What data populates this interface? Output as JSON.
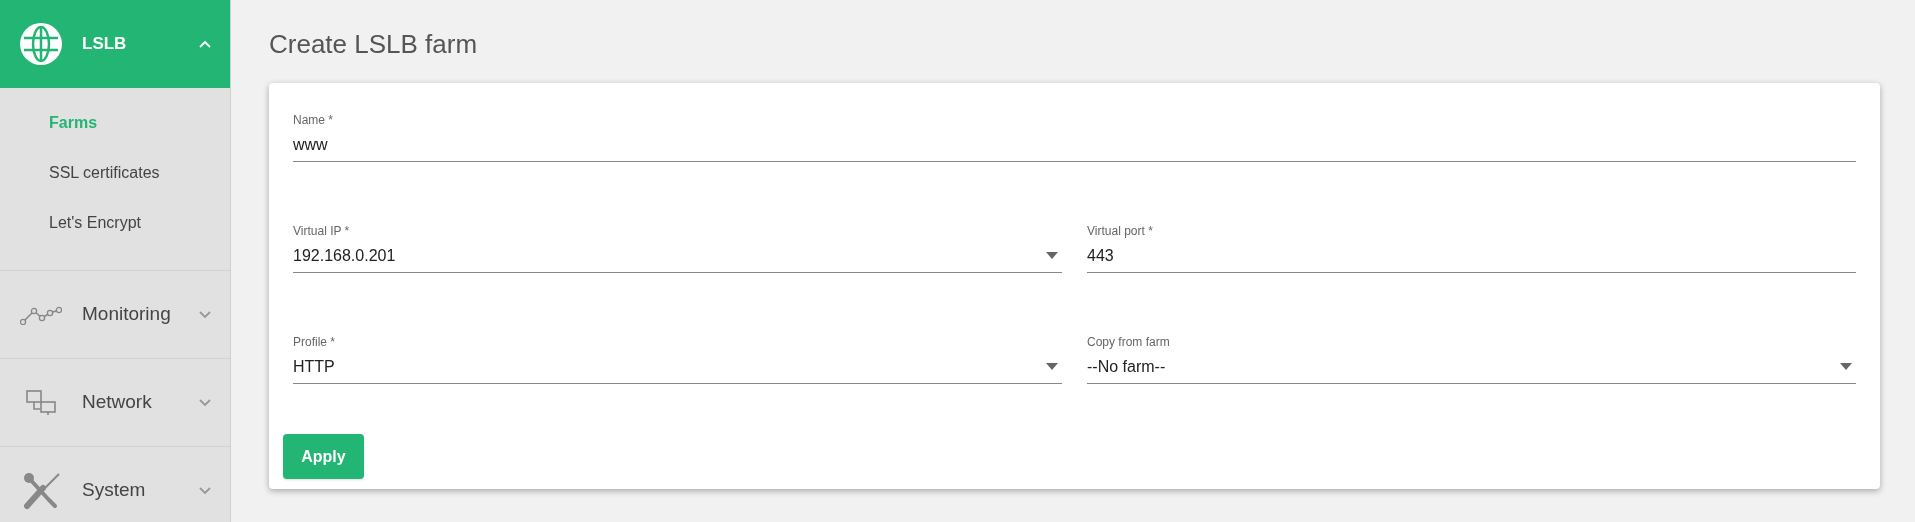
{
  "sidebar": {
    "sections": [
      {
        "label": "LSLB",
        "expanded": true,
        "selected": true,
        "items": [
          {
            "label": "Farms",
            "selected": true
          },
          {
            "label": "SSL certificates",
            "selected": false
          },
          {
            "label": "Let's Encrypt",
            "selected": false
          }
        ]
      },
      {
        "label": "Monitoring",
        "expanded": false,
        "selected": false
      },
      {
        "label": "Network",
        "expanded": false,
        "selected": false
      },
      {
        "label": "System",
        "expanded": false,
        "selected": false
      }
    ]
  },
  "page": {
    "title": "Create LSLB farm"
  },
  "form": {
    "rows": [
      [
        {
          "kind": "text",
          "label": "Name *",
          "value": "www"
        }
      ],
      [
        {
          "kind": "select",
          "label": "Virtual IP *",
          "value": "192.168.0.201"
        },
        {
          "kind": "text",
          "label": "Virtual port *",
          "value": "443"
        }
      ],
      [
        {
          "kind": "select",
          "label": "Profile *",
          "value": "HTTP"
        },
        {
          "kind": "select",
          "label": "Copy from farm",
          "value": "--No farm--"
        }
      ]
    ],
    "submit": "Apply"
  }
}
